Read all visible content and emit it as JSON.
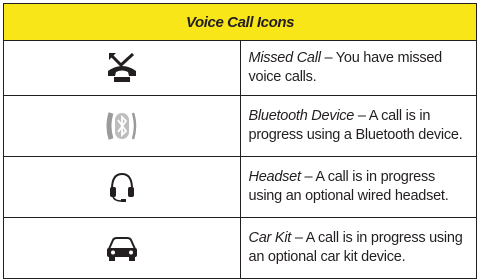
{
  "table": {
    "header": "Voice Call Icons",
    "rows": [
      {
        "icon": "missed-call-icon",
        "term": "Missed Call",
        "desc": " – You have missed voice calls."
      },
      {
        "icon": "bluetooth-device-icon",
        "term": "Bluetooth Device",
        "desc": " – A call is in progress using a Bluetooth device."
      },
      {
        "icon": "headset-icon",
        "term": "Headset",
        "desc": " – A call is in progress using an optional wired headset."
      },
      {
        "icon": "car-kit-icon",
        "term": "Car Kit",
        "desc": " – A call is in progress using an optional car kit device."
      }
    ]
  },
  "colors": {
    "header_bg": "#f9e619",
    "border": "#231f20",
    "text": "#231f20"
  }
}
